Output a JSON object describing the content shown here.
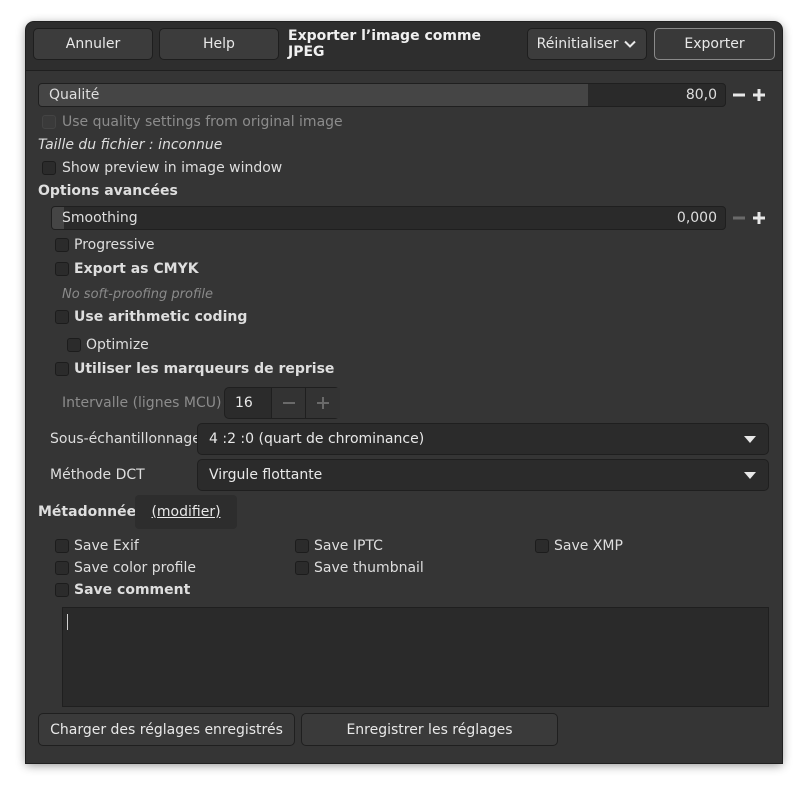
{
  "header": {
    "cancel": "Annuler",
    "help": "Help",
    "title": "Exporter l’image comme JPEG",
    "reset": "Réinitialiser",
    "export": "Exporter"
  },
  "quality": {
    "label": "Qualité",
    "value": "80,0",
    "fraction": 0.8
  },
  "use_original_quality": "Use quality settings from original image",
  "file_size": "Taille du fichier : inconnue",
  "show_preview": "Show preview in image window",
  "advanced": {
    "heading": "Options avancées",
    "smoothing": {
      "label": "Smoothing",
      "value": "0,000",
      "fraction": 0
    },
    "progressive": "Progressive",
    "export_cmyk": "Export as CMYK",
    "no_softproof": "No soft-proofing profile",
    "arithmetic": "Use arithmetic coding",
    "optimize": "Optimize",
    "restart_markers": "Utiliser les marqueurs de reprise",
    "interval_label": "Intervalle (lignes MCU) :",
    "interval_value": "16",
    "subsampling_label": "Sous-échantillonnage",
    "subsampling_value": "4 :2 :0 (quart de chrominance)",
    "dct_label": "Méthode DCT",
    "dct_value": "Virgule flottante"
  },
  "metadata": {
    "heading": "Métadonnées",
    "modify": "(modifier)",
    "save_exif": "Save Exif",
    "save_iptc": "Save IPTC",
    "save_xmp": "Save XMP",
    "save_color_profile": "Save color profile",
    "save_thumbnail": "Save thumbnail",
    "save_comment": "Save comment",
    "comment_text": ""
  },
  "footer": {
    "load": "Charger des réglages enregistrés",
    "save": "Enregistrer les réglages"
  }
}
